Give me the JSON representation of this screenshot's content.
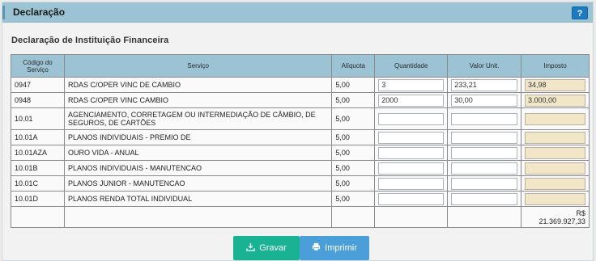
{
  "header": {
    "title": "Declaração",
    "help_label": "?"
  },
  "section_title": "Declaração de Instituição Financeira",
  "columns": [
    "Código do Serviço",
    "Serviço",
    "Alíquota",
    "Quantidade",
    "Valor Unit.",
    "Imposto"
  ],
  "rows": [
    {
      "codigo": "0947",
      "servico": "RDAS C/OPER VINC DE CAMBIO",
      "aliquota": "5,00",
      "quantidade": "3",
      "valor_unit": "233,21",
      "imposto": "34,98"
    },
    {
      "codigo": "0948",
      "servico": "RDAS C/OPER VINC CAMBIO",
      "aliquota": "5,00",
      "quantidade": "2000",
      "valor_unit": "30,00",
      "imposto": "3.000,00"
    },
    {
      "codigo": "10.01",
      "servico": "AGENCIAMENTO, CORRETAGEM OU INTERMEDIAÇÃO DE CÂMBIO, DE SEGUROS, DE CARTÕES",
      "aliquota": "5,00",
      "quantidade": "",
      "valor_unit": "",
      "imposto": ""
    },
    {
      "codigo": "10.01A",
      "servico": "PLANOS INDIVIDUAIS - PREMIO DE",
      "aliquota": "5,00",
      "quantidade": "",
      "valor_unit": "",
      "imposto": ""
    },
    {
      "codigo": "10.01AZA",
      "servico": "OURO VIDA - ANUAL",
      "aliquota": "5,00",
      "quantidade": "",
      "valor_unit": "",
      "imposto": ""
    },
    {
      "codigo": "10.01B",
      "servico": "PLANOS INDIVIDUAIS - MANUTENCAO",
      "aliquota": "5,00",
      "quantidade": "",
      "valor_unit": "",
      "imposto": ""
    },
    {
      "codigo": "10.01C",
      "servico": "PLANOS JUNIOR - MANUTENCAO",
      "aliquota": "5,00",
      "quantidade": "",
      "valor_unit": "",
      "imposto": ""
    },
    {
      "codigo": "10.01D",
      "servico": "PLANOS RENDA TOTAL INDIVIDUAL",
      "aliquota": "5,00",
      "quantidade": "",
      "valor_unit": "",
      "imposto": ""
    }
  ],
  "total": {
    "currency": "R$",
    "value": "21.369.927,33"
  },
  "buttons": {
    "gravar": "Gravar",
    "imprimir": "Imprimir"
  },
  "colors": {
    "header_bg": "#9cc3d4",
    "gravar": "#19b393",
    "imprimir": "#4a9fd8",
    "readonly_field": "#f1e7c8"
  }
}
